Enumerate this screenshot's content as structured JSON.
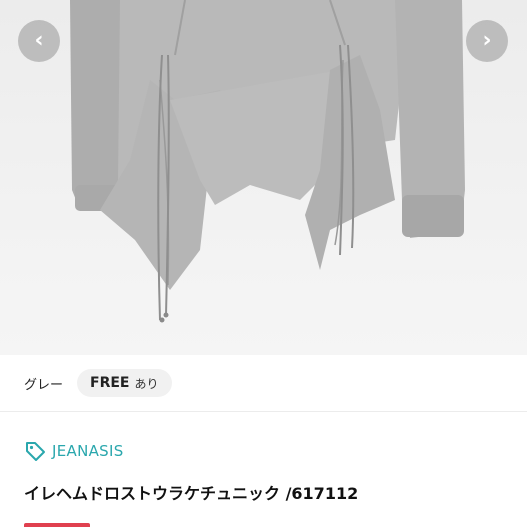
{
  "gallery": {
    "prev_icon": "chevron-left-icon",
    "next_icon": "chevron-right-icon",
    "prev_glyph": "‹",
    "next_glyph": "›"
  },
  "options": {
    "color": "グレー",
    "size_main": "FREE",
    "size_sub": "あり"
  },
  "brand": {
    "icon": "tag-icon",
    "name": "JEANASIS",
    "color": "#2aa7ad"
  },
  "product": {
    "title": "イレヘムドロストウラケチュニック /617112"
  },
  "badge_color": "#e0404f"
}
